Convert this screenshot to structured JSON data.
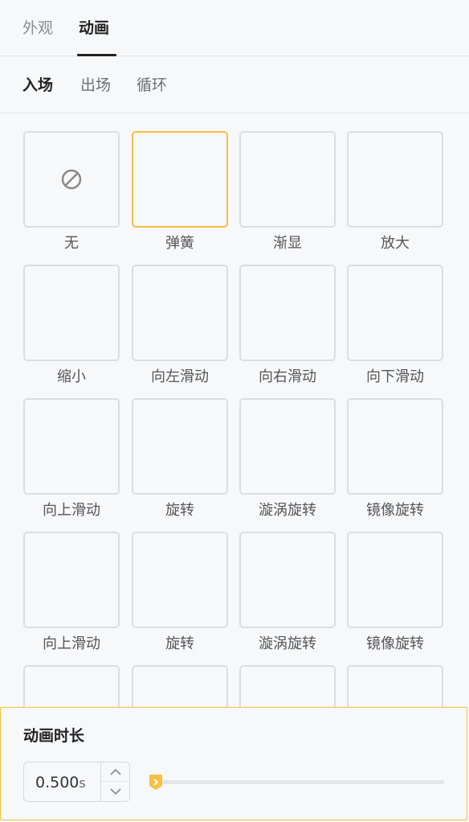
{
  "top_tabs": [
    {
      "label": "外观",
      "active": false
    },
    {
      "label": "动画",
      "active": true
    }
  ],
  "sub_tabs": [
    {
      "label": "入场",
      "active": true
    },
    {
      "label": "出场",
      "active": false
    },
    {
      "label": "循环",
      "active": false
    }
  ],
  "animations": [
    {
      "label": "无",
      "icon": "no-entry-icon"
    },
    {
      "label": "弹簧",
      "selected": true
    },
    {
      "label": "渐显"
    },
    {
      "label": "放大"
    },
    {
      "label": "缩小"
    },
    {
      "label": "向左滑动"
    },
    {
      "label": "向右滑动"
    },
    {
      "label": "向下滑动"
    },
    {
      "label": "向上滑动"
    },
    {
      "label": "旋转"
    },
    {
      "label": "漩涡旋转"
    },
    {
      "label": "镜像旋转"
    },
    {
      "label": "向上滑动"
    },
    {
      "label": "旋转"
    },
    {
      "label": "漩涡旋转"
    },
    {
      "label": "镜像旋转"
    },
    {
      "label": ""
    },
    {
      "label": ""
    },
    {
      "label": ""
    },
    {
      "label": ""
    }
  ],
  "duration": {
    "title": "动画时长",
    "value": "0.500",
    "unit": "s",
    "slider_fraction": 0.02
  },
  "colors": {
    "accent": "#f5c043",
    "text_dark": "#222222",
    "text_muted": "#8a8c90",
    "card_border": "#dcdde0"
  }
}
